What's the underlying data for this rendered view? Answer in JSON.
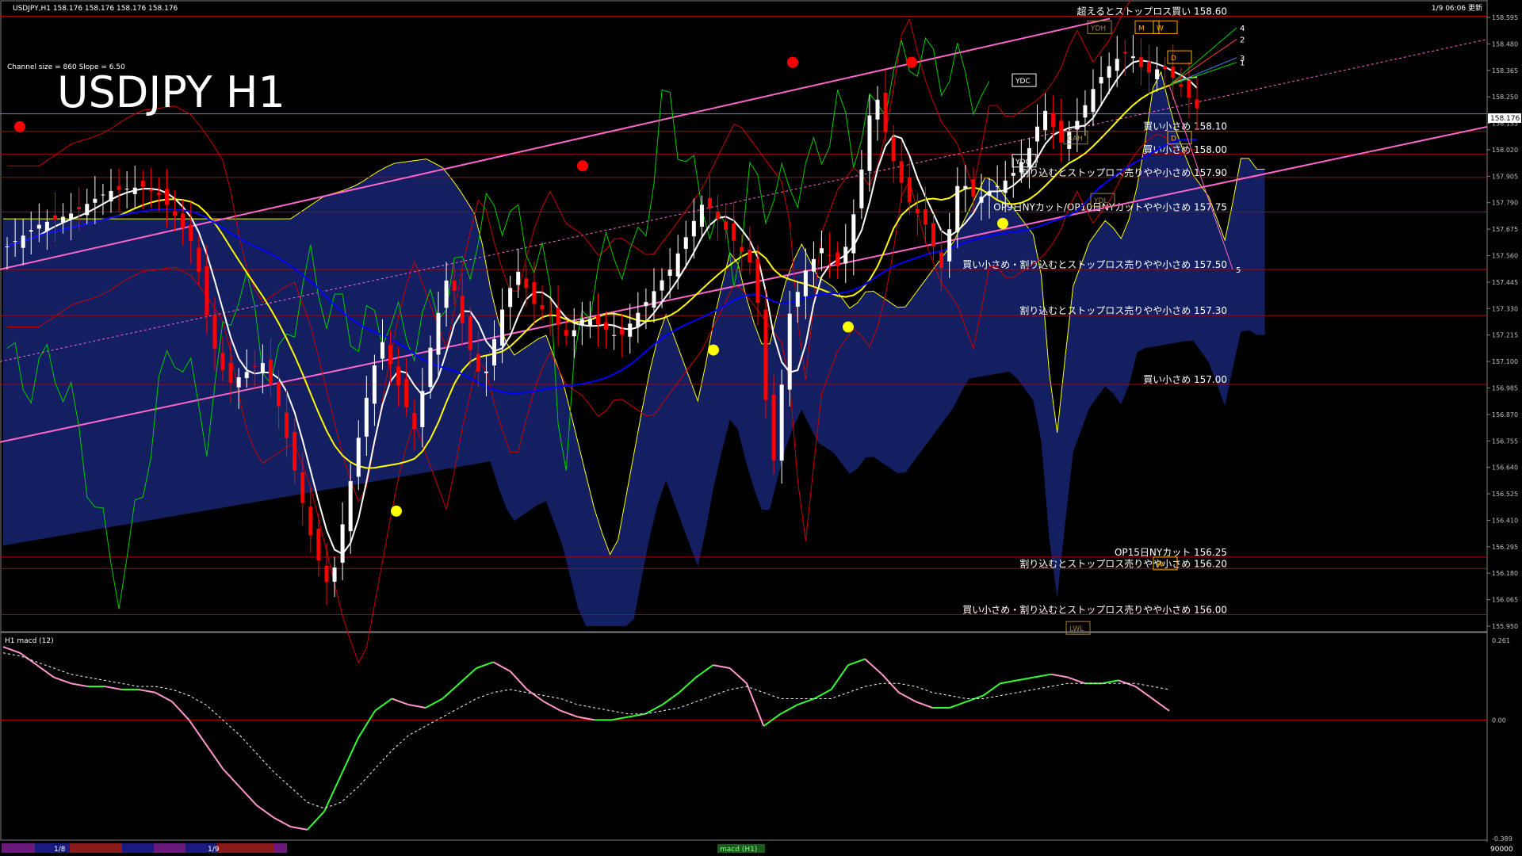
{
  "header": {
    "symbol_info": "USDJPY,H1  158.176 158.176 158.176 158.176",
    "timestamp": "1/9 06:06 更新",
    "channel_info": "Channel size = 860 Slope = 6.50",
    "big_title": "USDJPY H1"
  },
  "current_price": "158.176",
  "colors": {
    "background": "#000000",
    "bull_candle": "#ffffff",
    "bear_candle": "#ff0000",
    "ma_fast": "#ffffff",
    "ma_mid": "#ffff00",
    "ma_slow": "#0000ff",
    "channel": "#ff66cc",
    "level_line": "#b00000",
    "lagging_span": "#00cc00",
    "bollinger": "#cc0000",
    "cloud": "#1a2a80",
    "macd_up": "#33ff33",
    "macd_down": "#ff99cc",
    "signal": "#ffffff",
    "axis_text": "#c0c0c0"
  },
  "chart_data": [
    {
      "type": "candlestick",
      "title": "USDJPY H1",
      "ylim": [
        155.95,
        158.595
      ],
      "y_ticks": [
        "158.595",
        "158.480",
        "158.365",
        "158.250",
        "158.135",
        "158.020",
        "157.905",
        "157.790",
        "157.675",
        "157.560",
        "157.445",
        "157.330",
        "157.215",
        "157.100",
        "156.985",
        "156.870",
        "156.755",
        "156.640",
        "156.525",
        "156.410",
        "156.295",
        "156.180",
        "156.065",
        "155.950"
      ],
      "candle_count": 150,
      "close_path": [
        157.6,
        157.65,
        157.7,
        157.72,
        157.75,
        157.8,
        157.84,
        157.85,
        157.86,
        157.82,
        157.72,
        157.6,
        157.2,
        157.0,
        157.05,
        157.1,
        156.9,
        156.6,
        156.3,
        156.1,
        156.5,
        156.9,
        157.2,
        157.0,
        156.8,
        157.2,
        157.5,
        157.2,
        157.0,
        157.3,
        157.5,
        157.35,
        157.3,
        157.2,
        157.3,
        157.25,
        157.2,
        157.3,
        157.4,
        157.5,
        157.65,
        157.8,
        157.7,
        157.6,
        157.5,
        156.6,
        157.3,
        157.5,
        157.6,
        157.5,
        157.8,
        158.3,
        158.0,
        157.8,
        157.7,
        157.5,
        157.9,
        157.8,
        157.85,
        157.9,
        158.0,
        158.2,
        158.05,
        158.15,
        158.3,
        158.4,
        158.45,
        158.35,
        158.38,
        158.3,
        158.2
      ],
      "levels": [
        {
          "price": 158.6,
          "label": "超えるとストップロス買い 158.60"
        },
        {
          "price": 158.1,
          "label": "買い小さめ 158.10"
        },
        {
          "price": 158.0,
          "label": "買い小さめ 158.00"
        },
        {
          "price": 157.9,
          "label": "割り込むとストップロス売りやや小さめ 157.90"
        },
        {
          "price": 157.75,
          "label": "OP9日NYカット/OP10日NYカットやや小さめ 157.75"
        },
        {
          "price": 157.5,
          "label": "買い小さめ・割り込むとストップロス売りやや小さめ 157.50"
        },
        {
          "price": 157.3,
          "label": "割り込むとストップロス売りやや小さめ 157.30"
        },
        {
          "price": 157.0,
          "label": "買い小さめ 157.00"
        },
        {
          "price": 156.25,
          "label": "OP15日NYカット 156.25"
        },
        {
          "price": 156.2,
          "label": "割り込むとストップロス売りやや小さめ 156.20"
        },
        {
          "price": 156.0,
          "label": "買い小さめ・割り込むとストップロス売りやや小さめ 156.00"
        }
      ],
      "marker_labels": [
        "YDH",
        "M",
        "W",
        "D",
        "YDC",
        "YDO",
        "D",
        "YDL",
        "GAH",
        "LWL",
        "W"
      ],
      "projection_labels": [
        "4",
        "2",
        "3",
        "1",
        "5"
      ]
    },
    {
      "type": "line",
      "title": "H1  macd (12)",
      "ylim": [
        -0.389,
        0.261
      ],
      "y_ticks": [
        "0.261",
        "0.00",
        "-0.389"
      ],
      "zero_line": 0.0,
      "macd": [
        0.24,
        0.22,
        0.18,
        0.14,
        0.12,
        0.11,
        0.11,
        0.1,
        0.1,
        0.09,
        0.06,
        0.0,
        -0.08,
        -0.16,
        -0.22,
        -0.28,
        -0.32,
        -0.35,
        -0.36,
        -0.3,
        -0.18,
        -0.06,
        0.03,
        0.07,
        0.05,
        0.04,
        0.07,
        0.12,
        0.17,
        0.19,
        0.16,
        0.1,
        0.06,
        0.03,
        0.01,
        0.0,
        0.0,
        0.01,
        0.02,
        0.05,
        0.09,
        0.14,
        0.18,
        0.17,
        0.12,
        -0.02,
        0.02,
        0.05,
        0.07,
        0.1,
        0.18,
        0.2,
        0.15,
        0.09,
        0.06,
        0.04,
        0.04,
        0.06,
        0.08,
        0.12,
        0.13,
        0.14,
        0.15,
        0.14,
        0.12,
        0.12,
        0.13,
        0.11,
        0.07,
        0.03
      ],
      "signal": [
        0.22,
        0.21,
        0.19,
        0.17,
        0.15,
        0.14,
        0.13,
        0.12,
        0.11,
        0.11,
        0.1,
        0.08,
        0.05,
        0.0,
        -0.05,
        -0.11,
        -0.17,
        -0.22,
        -0.27,
        -0.29,
        -0.27,
        -0.22,
        -0.16,
        -0.1,
        -0.05,
        -0.02,
        0.01,
        0.04,
        0.07,
        0.09,
        0.1,
        0.09,
        0.08,
        0.07,
        0.05,
        0.04,
        0.03,
        0.02,
        0.02,
        0.03,
        0.04,
        0.06,
        0.08,
        0.1,
        0.11,
        0.09,
        0.07,
        0.07,
        0.07,
        0.07,
        0.09,
        0.11,
        0.12,
        0.12,
        0.11,
        0.09,
        0.08,
        0.07,
        0.07,
        0.08,
        0.09,
        0.1,
        0.11,
        0.12,
        0.12,
        0.12,
        0.12,
        0.12,
        0.11,
        0.1
      ]
    }
  ],
  "bottom_bar": {
    "date_labels": [
      "1/8",
      "1/9"
    ],
    "indicator_label": "macd (H1)",
    "volume_label": "90000"
  }
}
